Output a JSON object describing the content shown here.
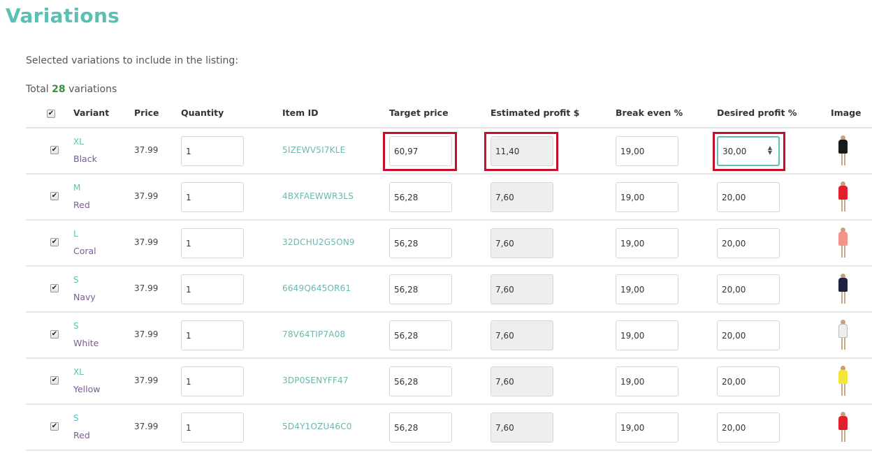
{
  "page": {
    "title": "Variations",
    "subtitle": "Selected variations to include in the listing:",
    "total_prefix": "Total",
    "total_count": "28",
    "total_suffix": "variations"
  },
  "table": {
    "header_checked": true,
    "columns": [
      "Variant",
      "Price",
      "Quantity",
      "Item ID",
      "Target price",
      "Estimated profit $",
      "Break even %",
      "Desired profit %",
      "Image"
    ],
    "rows": [
      {
        "checked": true,
        "size": "XL",
        "color": "Black",
        "price": "37.99",
        "quantity": "1",
        "item_id": "5IZEWV5I7KLE",
        "target_price": "60,97",
        "estimated_profit": "11,40",
        "break_even": "19,00",
        "desired_profit": "30,00",
        "image": "black-dress-icon",
        "swatch": "#1a1a1a"
      },
      {
        "checked": true,
        "size": "M",
        "color": "Red",
        "price": "37.99",
        "quantity": "1",
        "item_id": "4BXFAEWWR3LS",
        "target_price": "56,28",
        "estimated_profit": "7,60",
        "break_even": "19,00",
        "desired_profit": "20,00",
        "image": "red-dress-icon",
        "swatch": "#e0212b"
      },
      {
        "checked": true,
        "size": "L",
        "color": "Coral",
        "price": "37.99",
        "quantity": "1",
        "item_id": "32DCHU2G5ON9",
        "target_price": "56,28",
        "estimated_profit": "7,60",
        "break_even": "19,00",
        "desired_profit": "20,00",
        "image": "coral-dress-icon",
        "swatch": "#f4938a"
      },
      {
        "checked": true,
        "size": "S",
        "color": "Navy",
        "price": "37.99",
        "quantity": "1",
        "item_id": "6649Q645OR61",
        "target_price": "56,28",
        "estimated_profit": "7,60",
        "break_even": "19,00",
        "desired_profit": "20,00",
        "image": "navy-dress-icon",
        "swatch": "#1c2340"
      },
      {
        "checked": true,
        "size": "S",
        "color": "White",
        "price": "37.99",
        "quantity": "1",
        "item_id": "78V64TIP7A08",
        "target_price": "56,28",
        "estimated_profit": "7,60",
        "break_even": "19,00",
        "desired_profit": "20,00",
        "image": "white-dress-icon",
        "swatch": "#eeeeee"
      },
      {
        "checked": true,
        "size": "XL",
        "color": "Yellow",
        "price": "37.99",
        "quantity": "1",
        "item_id": "3DP0SENYFF47",
        "target_price": "56,28",
        "estimated_profit": "7,60",
        "break_even": "19,00",
        "desired_profit": "20,00",
        "image": "yellow-dress-icon",
        "swatch": "#f2e63a"
      },
      {
        "checked": true,
        "size": "S",
        "color": "Red",
        "price": "37.99",
        "quantity": "1",
        "item_id": "5D4Y1OZU46C0",
        "target_price": "56,28",
        "estimated_profit": "7,60",
        "break_even": "19,00",
        "desired_profit": "20,00",
        "image": "red-dress-icon",
        "swatch": "#e0212b"
      }
    ]
  },
  "highlight_color": "#c8102e",
  "accent_color": "#5bbfb3"
}
